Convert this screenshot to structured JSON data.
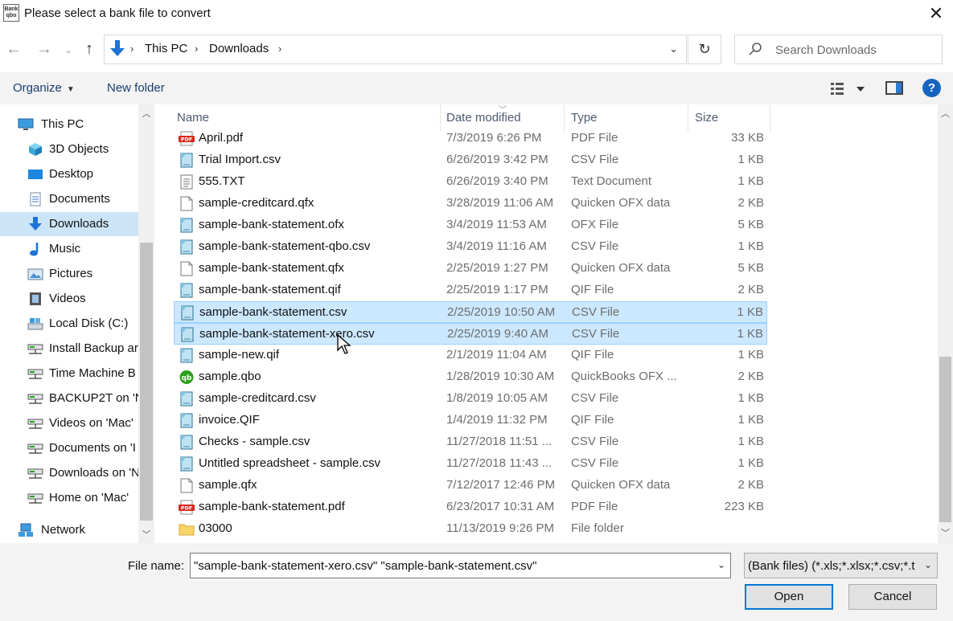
{
  "window": {
    "app_icon_text": "Bank qbo",
    "title": "Please select a bank file to convert",
    "close_glyph": "✕"
  },
  "nav": {
    "back_glyph": "←",
    "forward_glyph": "→",
    "recent_glyph": "⌄",
    "up_glyph": "↑",
    "breadcrumb": [
      "This PC",
      "Downloads"
    ],
    "separator": "›",
    "refresh_glyph": "↻",
    "search_placeholder": "Search Downloads"
  },
  "toolbar": {
    "organize": "Organize",
    "new_folder": "New folder",
    "help_glyph": "?"
  },
  "sidebar": {
    "items": [
      {
        "label": "This PC",
        "icon": "computer-icon"
      },
      {
        "label": "3D Objects",
        "icon": "cube-icon"
      },
      {
        "label": "Desktop",
        "icon": "desktop-icon"
      },
      {
        "label": "Documents",
        "icon": "documents-icon"
      },
      {
        "label": "Downloads",
        "icon": "downloads-icon",
        "selected": true
      },
      {
        "label": "Music",
        "icon": "music-icon"
      },
      {
        "label": "Pictures",
        "icon": "pictures-icon"
      },
      {
        "label": "Videos",
        "icon": "videos-icon"
      },
      {
        "label": "Local Disk (C:)",
        "icon": "drive-icon"
      },
      {
        "label": "Install Backup ar",
        "icon": "network-drive-icon"
      },
      {
        "label": "Time Machine B",
        "icon": "network-drive-icon"
      },
      {
        "label": "BACKUP2T on 'N",
        "icon": "network-drive-icon"
      },
      {
        "label": "Videos on 'Mac'",
        "icon": "network-drive-icon"
      },
      {
        "label": "Documents on 'I",
        "icon": "network-drive-icon"
      },
      {
        "label": "Downloads on 'N",
        "icon": "network-drive-icon"
      },
      {
        "label": "Home on 'Mac'",
        "icon": "network-drive-icon"
      },
      {
        "label": "Network",
        "icon": "network-icon"
      }
    ]
  },
  "columns": {
    "name": "Name",
    "date": "Date modified",
    "type": "Type",
    "size": "Size"
  },
  "files": [
    {
      "name": "April.pdf",
      "date": "7/3/2019 6:26 PM",
      "type": "PDF File",
      "size": "33 KB",
      "icon": "pdf"
    },
    {
      "name": "Trial Import.csv",
      "date": "6/26/2019 3:42 PM",
      "type": "CSV File",
      "size": "1 KB",
      "icon": "csv"
    },
    {
      "name": "555.TXT",
      "date": "6/26/2019 3:40 PM",
      "type": "Text Document",
      "size": "1 KB",
      "icon": "txt"
    },
    {
      "name": "sample-creditcard.qfx",
      "date": "3/28/2019 11:06 AM",
      "type": "Quicken OFX data",
      "size": "2 KB",
      "icon": "blank"
    },
    {
      "name": "sample-bank-statement.ofx",
      "date": "3/4/2019 11:53 AM",
      "type": "OFX File",
      "size": "5 KB",
      "icon": "csv"
    },
    {
      "name": "sample-bank-statement-qbo.csv",
      "date": "3/4/2019 11:16 AM",
      "type": "CSV File",
      "size": "1 KB",
      "icon": "csv"
    },
    {
      "name": "sample-bank-statement.qfx",
      "date": "2/25/2019 1:27 PM",
      "type": "Quicken OFX data",
      "size": "5 KB",
      "icon": "blank"
    },
    {
      "name": "sample-bank-statement.qif",
      "date": "2/25/2019 1:17 PM",
      "type": "QIF File",
      "size": "2 KB",
      "icon": "csv"
    },
    {
      "name": "sample-bank-statement.csv",
      "date": "2/25/2019 10:50 AM",
      "type": "CSV File",
      "size": "1 KB",
      "icon": "csv",
      "selected": true
    },
    {
      "name": "sample-bank-statement-xero.csv",
      "date": "2/25/2019 9:40 AM",
      "type": "CSV File",
      "size": "1 KB",
      "icon": "csv",
      "selected": true
    },
    {
      "name": "sample-new.qif",
      "date": "2/1/2019 11:04 AM",
      "type": "QIF File",
      "size": "1 KB",
      "icon": "csv"
    },
    {
      "name": "sample.qbo",
      "date": "1/28/2019 10:30 AM",
      "type": "QuickBooks OFX ...",
      "size": "2 KB",
      "icon": "qbo"
    },
    {
      "name": "sample-creditcard.csv",
      "date": "1/8/2019 10:05 AM",
      "type": "CSV File",
      "size": "1 KB",
      "icon": "csv"
    },
    {
      "name": "invoice.QIF",
      "date": "1/4/2019 11:32 PM",
      "type": "QIF File",
      "size": "1 KB",
      "icon": "csv"
    },
    {
      "name": "Checks - sample.csv",
      "date": "11/27/2018 11:51 ...",
      "type": "CSV File",
      "size": "1 KB",
      "icon": "csv"
    },
    {
      "name": "Untitled spreadsheet - sample.csv",
      "date": "11/27/2018 11:43 ...",
      "type": "CSV File",
      "size": "1 KB",
      "icon": "csv"
    },
    {
      "name": "sample.qfx",
      "date": "7/12/2017 12:46 PM",
      "type": "Quicken OFX data",
      "size": "2 KB",
      "icon": "blank"
    },
    {
      "name": "sample-bank-statement.pdf",
      "date": "6/23/2017 10:31 AM",
      "type": "PDF File",
      "size": "223 KB",
      "icon": "pdf"
    },
    {
      "name": "03000",
      "date": "11/13/2019 9:26 PM",
      "type": "File folder",
      "size": "",
      "icon": "folder"
    }
  ],
  "footer": {
    "file_name_label": "File name:",
    "file_name_value": "\"sample-bank-statement-xero.csv\" \"sample-bank-statement.csv\"",
    "filter": "(Bank files) (*.xls;*.xlsx;*.csv;*.t",
    "open": "Open",
    "cancel": "Cancel"
  },
  "colors": {
    "selection_bg": "#cce8ff",
    "selection_border": "#99d1ff",
    "accent": "#0078d7",
    "toolbar_bg": "#f3f3f3"
  }
}
